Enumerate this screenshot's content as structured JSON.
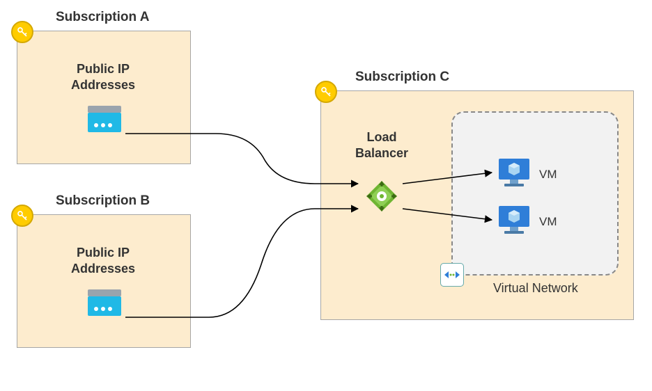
{
  "diagram": {
    "sub_a": {
      "title": "Subscription A",
      "label": "Public IP\nAddresses"
    },
    "sub_b": {
      "title": "Subscription B",
      "label": "Public IP\nAddresses"
    },
    "sub_c": {
      "title": "Subscription C",
      "lb_label": "Load\nBalancer",
      "vnet_label": "Virtual Network",
      "vm1": "VM",
      "vm2": "VM"
    },
    "colors": {
      "sub_bg": "#fdecce",
      "key": "#ffcc00",
      "ip_blue": "#20b9e6",
      "lb_green": "#6fb532",
      "vm_blue": "#2f7ed8"
    }
  }
}
